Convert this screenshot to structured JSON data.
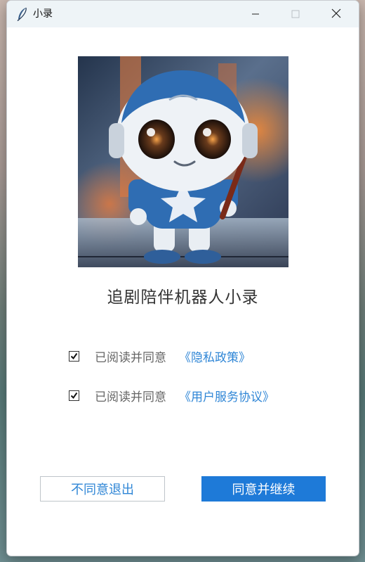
{
  "window": {
    "title": "小录"
  },
  "hero": {
    "subtitle": "追剧陪伴机器人小录"
  },
  "agreements": [
    {
      "text": "已阅读并同意",
      "link": "《隐私政策》",
      "checked": true
    },
    {
      "text": "已阅读并同意",
      "link": "《用户服务协议》",
      "checked": true
    }
  ],
  "buttons": {
    "decline": "不同意退出",
    "accept": "同意并继续"
  },
  "colors": {
    "accent": "#1e7ad8",
    "link": "#2f86d6",
    "titlebar": "#eef4f7"
  },
  "icons": {
    "app": "feather-icon",
    "minimize": "minimize-icon",
    "maximize": "maximize-icon",
    "close": "close-icon"
  }
}
